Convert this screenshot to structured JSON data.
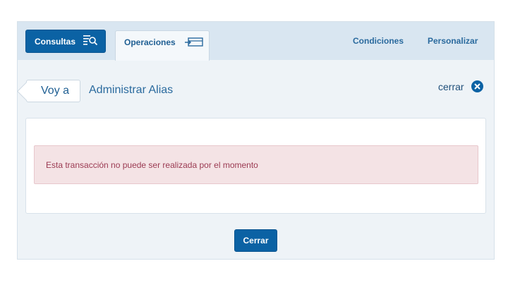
{
  "header": {
    "consultas_label": "Consultas",
    "operaciones_label": "Operaciones",
    "condiciones_label": "Condiciones",
    "personalizar_label": "Personalizar"
  },
  "nav": {
    "voy_a_label": "Voy a",
    "page_title": "Administrar Alias",
    "cerrar_label": "cerrar"
  },
  "message": {
    "text": "Esta transacción no puede ser realizada por el momento"
  },
  "footer": {
    "cerrar_button_label": "Cerrar"
  },
  "colors": {
    "primary": "#0b62a4",
    "header_bg": "#d9e6f1",
    "page_bg": "#eef3f7",
    "alert_bg": "#f4e3e5",
    "alert_text": "#9b3a52"
  },
  "icons": {
    "consultas": "search-list-icon",
    "operaciones": "transfer-card-icon",
    "close": "close-circle-icon"
  }
}
